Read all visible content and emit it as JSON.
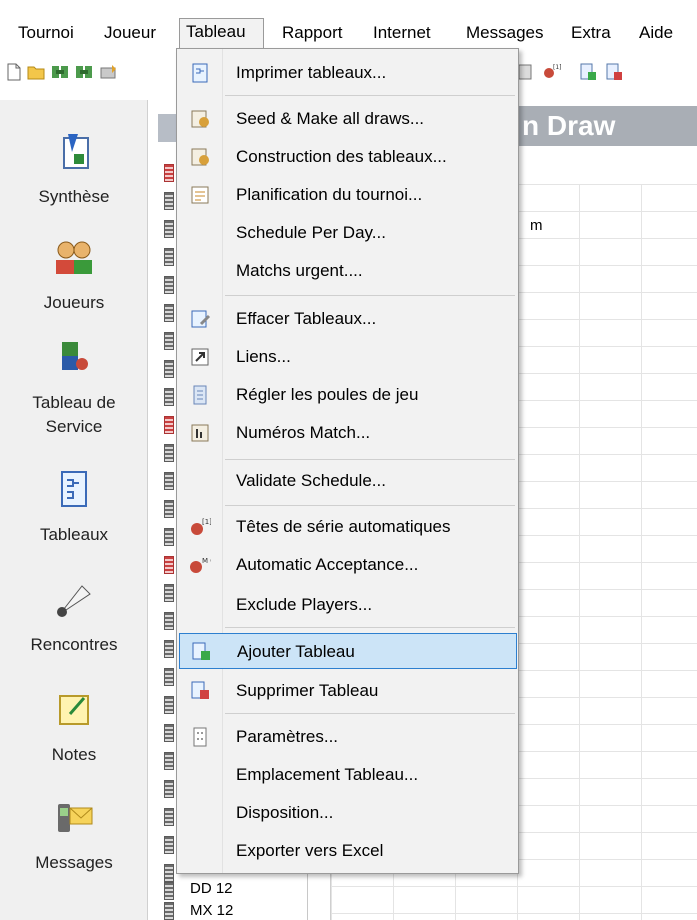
{
  "menubar": {
    "items": [
      {
        "label": "Tournoi"
      },
      {
        "label": "Joueur"
      },
      {
        "label": "Tableau"
      },
      {
        "label": "Rapport"
      },
      {
        "label": "Internet"
      },
      {
        "label": "Messages"
      },
      {
        "label": "Extra"
      },
      {
        "label": "Aide"
      }
    ]
  },
  "toolbar": {
    "icons": [
      "new-icon",
      "open-icon",
      "tool-icon",
      "tool-icon",
      "tool-icon",
      "tool-icon",
      "seed-icon",
      "draw-icon",
      "draw-icon"
    ],
    "seed_superscript": "[1]"
  },
  "sidebar": {
    "items": [
      {
        "label": "Synthèse",
        "icon": "summary-icon"
      },
      {
        "label": "Joueurs",
        "icon": "players-icon"
      },
      {
        "label": "Tableau de\nService",
        "icon": "service-table-icon"
      },
      {
        "label": "Tableaux",
        "icon": "draws-icon"
      },
      {
        "label": "Rencontres",
        "icon": "shuttlecock-icon"
      },
      {
        "label": "Notes",
        "icon": "notes-icon"
      },
      {
        "label": "Messages",
        "icon": "messages-icon"
      }
    ]
  },
  "tree": {
    "visible_labels": [
      "DD 12",
      "MX 12"
    ]
  },
  "main": {
    "header_title": "n Draw",
    "grid_text": "m"
  },
  "dropdown": {
    "items": [
      {
        "label": "Imprimer tableaux...",
        "icon": "print-draw-icon"
      },
      {
        "label": "Seed & Make all draws...",
        "icon": "seed-draws-icon"
      },
      {
        "label": "Construction des tableaux...",
        "icon": "build-draws-icon"
      },
      {
        "label": "Planification du tournoi...",
        "icon": "schedule-icon"
      },
      {
        "label": "Schedule Per Day...",
        "icon": ""
      },
      {
        "label": "Matchs urgent....",
        "icon": ""
      },
      {
        "label": "Effacer Tableaux...",
        "icon": "erase-draws-icon"
      },
      {
        "label": "Liens...",
        "icon": "link-icon"
      },
      {
        "label": "Régler les poules de jeu",
        "icon": "pools-icon"
      },
      {
        "label": "Numéros Match...",
        "icon": "match-numbers-icon"
      },
      {
        "label": "Validate Schedule...",
        "icon": ""
      },
      {
        "label": "Têtes de série automatiques",
        "icon": "auto-seed-icon"
      },
      {
        "label": "Automatic Acceptance...",
        "icon": "auto-accept-icon"
      },
      {
        "label": "Exclude Players...",
        "icon": ""
      },
      {
        "label": "Ajouter Tableau",
        "icon": "add-draw-icon"
      },
      {
        "label": "Supprimer Tableau",
        "icon": "remove-draw-icon"
      },
      {
        "label": "Paramètres...",
        "icon": "settings-icon"
      },
      {
        "label": "Emplacement Tableau...",
        "icon": ""
      },
      {
        "label": "Disposition...",
        "icon": ""
      },
      {
        "label": "Exporter vers Excel",
        "icon": ""
      }
    ],
    "highlighted_label": "Ajouter Tableau",
    "seed_superscript": "[1]",
    "accept_letters": "M Q"
  },
  "colors": {
    "highlight_bg": "#cce4f7",
    "highlight_border": "#2d7fcf",
    "menu_bg": "#f2f2f2",
    "header_grey": "#a9aeb5"
  }
}
